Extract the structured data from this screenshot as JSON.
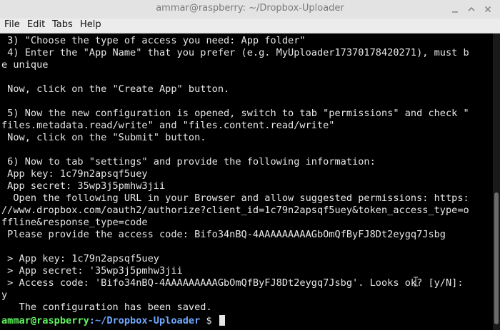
{
  "window": {
    "title": "ammar@raspberry: ~/Dropbox-Uploader"
  },
  "menu": [
    "File",
    "Edit",
    "Tabs",
    "Help"
  ],
  "terminal_lines": [
    " 3) \"Choose the type of access you need: App folder\"",
    " 4) Enter the \"App Name\" that you prefer (e.g. MyUploader17370178420271), must b",
    "e unique",
    "",
    " Now, click on the \"Create App\" button.",
    "",
    " 5) Now the new configuration is opened, switch to tab \"permissions\" and check \"",
    "files.metadata.read/write\" and \"files.content.read/write\"",
    " Now, click on the \"Submit\" button.",
    "",
    " 6) Now to tab \"settings\" and provide the following information:",
    " App key: 1c79n2apsqf5uey",
    " App secret: 35wp3j5pmhw3jii",
    "  Open the following URL in your Browser and allow suggested permissions: https:",
    "//www.dropbox.com/oauth2/authorize?client_id=1c79n2apsqf5uey&token_access_type=o",
    "ffline&response_type=code",
    " Please provide the access code: Bifo34nBQ-4AAAAAAAAAGbOmQfByFJ8Dt2eygq7Jsbg",
    "",
    " > App key: 1c79n2apsqf5uey",
    " > App secret: '35wp3j5pmhw3jii",
    " > Access code: 'Bifo34nBQ-4AAAAAAAAAGbOmQfByFJ8Dt2eygq7Jsbg'. Looks ok? [y/N]:",
    "y",
    "   The configuration has been saved."
  ],
  "prompt": {
    "user_host": "ammar@raspberry",
    "path": ":~/Dropbox-Uploader",
    "symbol": " $ "
  },
  "colors": {
    "background": "#000000",
    "text": "#e6e6e6",
    "prompt_user": "#5ff75f",
    "prompt_path": "#6ea8ff"
  }
}
